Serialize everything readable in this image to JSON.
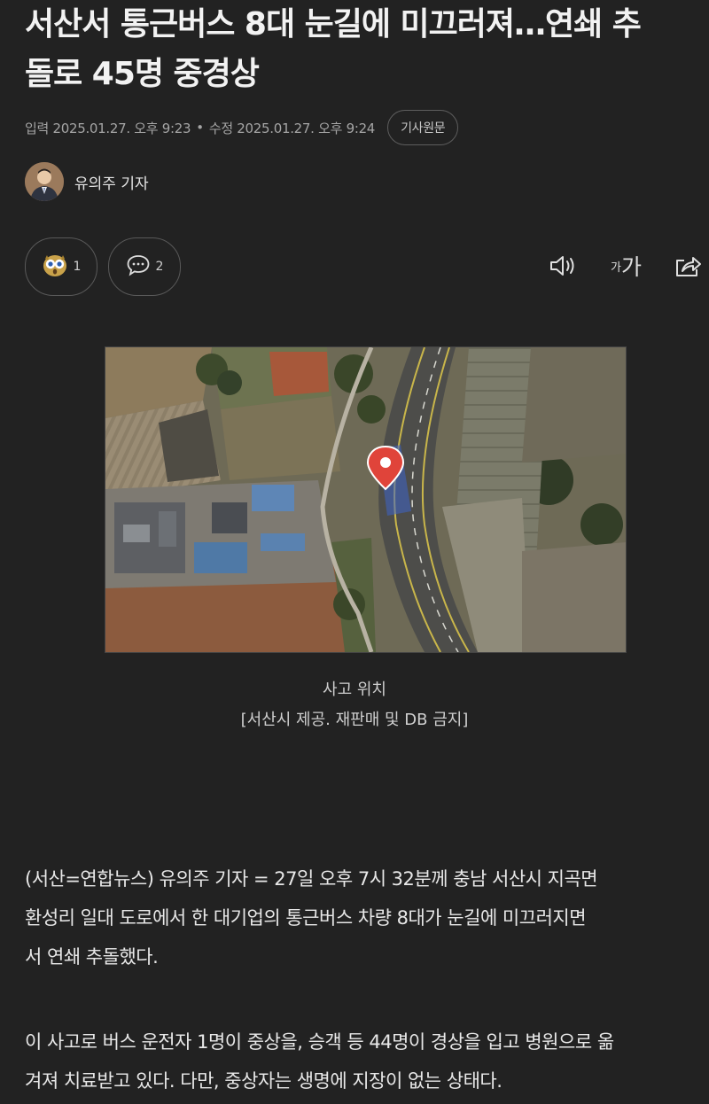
{
  "article": {
    "headline_line1": "서산서 통근버스 8대 눈길에 미끄러져…연쇄 추",
    "headline_line2": "돌로 45명 중경상",
    "published": "입력 2025.01.27. 오후 9:23",
    "separator": "•",
    "modified": "수정 2025.01.27. 오후 9:24",
    "original_button": "기사원문",
    "author": "유의주 기자",
    "reaction_count": "1",
    "comment_count": "2",
    "font_size_small": "가",
    "font_size_big": "가",
    "caption_line1": "사고 위치",
    "caption_line2": "[서산시 제공. 재판매 및 DB 금지]",
    "body_p1_l1": "(서산=연합뉴스) 유의주 기자 = 27일 오후 7시 32분께 충남 서산시 지곡면",
    "body_p1_l2": "환성리 일대 도로에서 한 대기업의 통근버스 차량 8대가 눈길에 미끄러지면",
    "body_p1_l3": "서 연쇄 추돌했다.",
    "body_p2_l1": "이 사고로 버스 운전자 1명이 중상을, 승객 등 44명이 경상을 입고 병원으로 옮",
    "body_p2_l2": "겨져 치료받고 있다. 다만, 중상자는 생명에 지장이 없는 상태다."
  },
  "icons": {
    "reaction": "surprised-owl-icon",
    "comment": "comment-bubble-icon",
    "audio": "speaker-icon",
    "share": "share-icon"
  },
  "colors": {
    "background": "#222222",
    "text": "#e6e6e6",
    "muted": "#a5a5a5",
    "pin": "#e0443a"
  }
}
